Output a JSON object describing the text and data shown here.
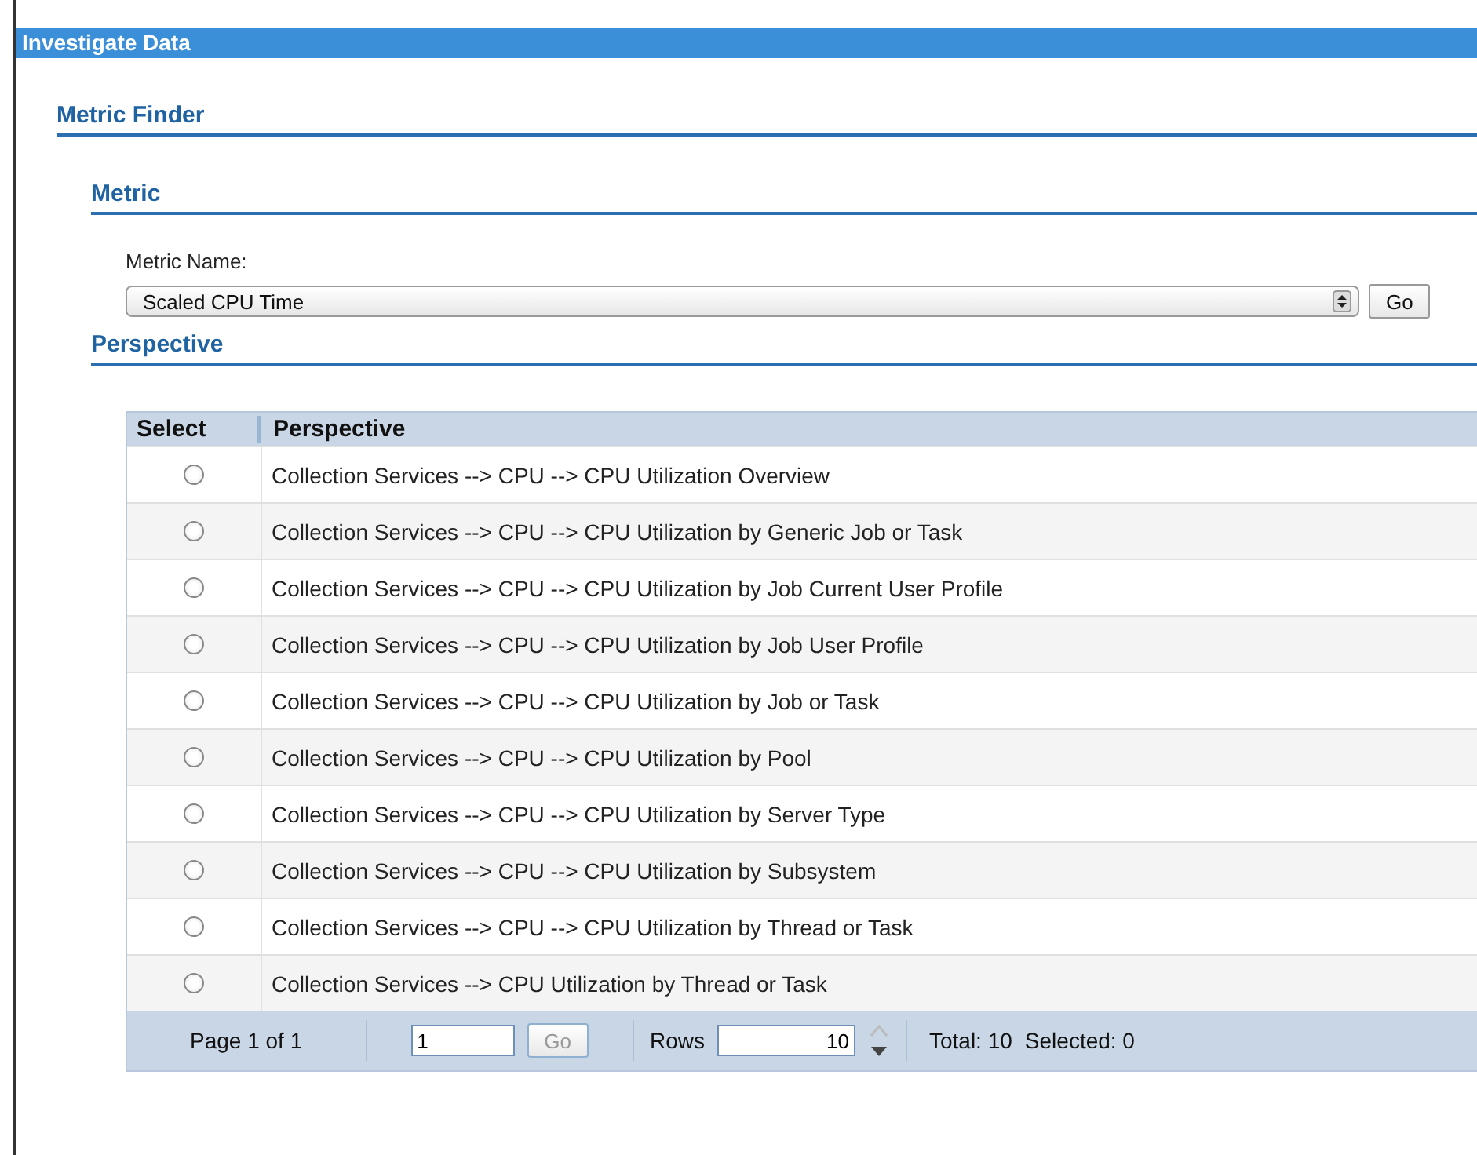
{
  "window": {
    "title": "Investigate Data"
  },
  "section": {
    "title": "Metric Finder"
  },
  "metric": {
    "title": "Metric",
    "label": "Metric Name:",
    "value": "Scaled CPU Time",
    "go": "Go"
  },
  "perspective": {
    "title": "Perspective"
  },
  "table": {
    "columns": [
      "Select",
      "Perspective"
    ],
    "rows": [
      {
        "text": "Collection Services --> CPU --> CPU Utilization Overview",
        "selected": false
      },
      {
        "text": "Collection Services --> CPU --> CPU Utilization by Generic Job or Task",
        "selected": false
      },
      {
        "text": "Collection Services --> CPU --> CPU Utilization by Job Current User Profile",
        "selected": false
      },
      {
        "text": "Collection Services --> CPU --> CPU Utilization by Job User Profile",
        "selected": false
      },
      {
        "text": "Collection Services --> CPU --> CPU Utilization by Job or Task",
        "selected": false
      },
      {
        "text": "Collection Services --> CPU --> CPU Utilization by Pool",
        "selected": false
      },
      {
        "text": "Collection Services --> CPU --> CPU Utilization by Server Type",
        "selected": false
      },
      {
        "text": "Collection Services --> CPU --> CPU Utilization by Subsystem",
        "selected": false
      },
      {
        "text": "Collection Services --> CPU --> CPU Utilization by Thread or Task",
        "selected": false
      },
      {
        "text": "Collection Services --> CPU Utilization by Thread or Task",
        "selected": false
      }
    ]
  },
  "footer": {
    "page": "Page 1 of 1",
    "page_value": "1",
    "go": "Go",
    "go_disabled": true,
    "rows_label": "Rows",
    "rows_value": "10",
    "total": "Total: 10",
    "selected": "Selected: 0"
  }
}
